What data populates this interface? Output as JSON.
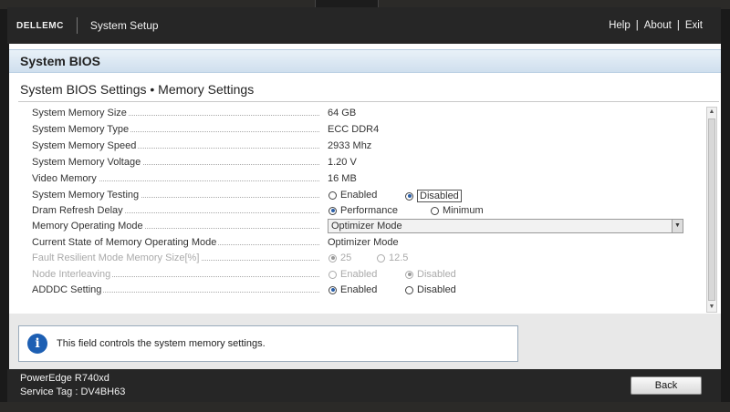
{
  "header": {
    "brand": "DELLEMC",
    "app_title": "System Setup",
    "links": [
      "Help",
      "About",
      "Exit"
    ],
    "separator": "|"
  },
  "title_bar": "System BIOS",
  "page_title": "System BIOS Settings • Memory Settings",
  "rows": {
    "memory_size": {
      "label": "System Memory Size",
      "value": "64 GB"
    },
    "memory_type": {
      "label": "System Memory Type",
      "value": "ECC DDR4"
    },
    "memory_speed": {
      "label": "System Memory Speed",
      "value": "2933 Mhz"
    },
    "memory_voltage": {
      "label": "System Memory Voltage",
      "value": "1.20 V"
    },
    "video_memory": {
      "label": "Video Memory",
      "value": "16 MB"
    },
    "memory_testing": {
      "label": "System Memory Testing",
      "options": [
        "Enabled",
        "Disabled"
      ],
      "selected": "Disabled"
    },
    "dram_refresh": {
      "label": "Dram Refresh Delay",
      "options": [
        "Performance",
        "Minimum"
      ],
      "selected": "Performance"
    },
    "operating_mode": {
      "label": "Memory Operating Mode",
      "value": "Optimizer Mode"
    },
    "current_mode": {
      "label": "Current State of Memory Operating Mode",
      "value": "Optimizer Mode"
    },
    "fault_resilient": {
      "label": "Fault Resilient Mode Memory Size[%]",
      "options": [
        "25",
        "12.5"
      ],
      "selected": "25"
    },
    "node_interleaving": {
      "label": "Node Interleaving",
      "options": [
        "Enabled",
        "Disabled"
      ],
      "selected": "Disabled"
    },
    "adddc": {
      "label": "ADDDC Setting",
      "options": [
        "Enabled",
        "Disabled"
      ],
      "selected": "Enabled"
    }
  },
  "help_text": "This field controls the system memory settings.",
  "footer": {
    "model": "PowerEdge R740xd",
    "service_tag": "Service Tag : DV4BH63",
    "back_label": "Back"
  },
  "icons": {
    "info": "info-icon",
    "dropdown": "chevron-down-icon"
  },
  "colors": {
    "header_bg": "#262626",
    "accent_blue": "#1d5fb3",
    "title_bar": "#d6e4f0"
  }
}
